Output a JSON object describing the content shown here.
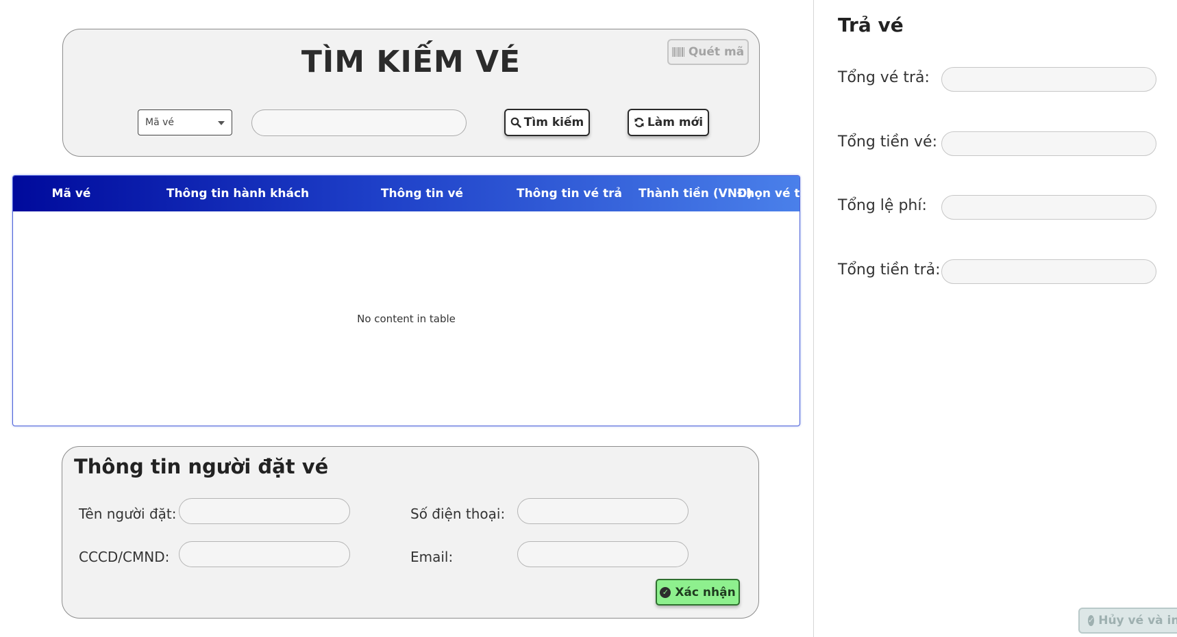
{
  "search": {
    "title": "TÌM KIẾM VÉ",
    "scan_label": "Quét mã",
    "select_value": "Mã vé",
    "input_value": "",
    "search_label": "Tìm kiếm",
    "refresh_label": "Làm mới"
  },
  "table": {
    "columns": [
      "Mã vé",
      "Thông tin hành khách",
      "Thông tin vé",
      "Thông tin vé trả",
      "Thành tiền (VNĐ)",
      "Chọn vé trả"
    ],
    "empty_message": "No content in table",
    "header_colors": [
      "#000a9c",
      "#1d3ec7",
      "#4a80ea"
    ]
  },
  "booker": {
    "title": "Thông tin người đặt vé",
    "name_label": "Tên người đặt:",
    "phone_label": "Số điện thoại:",
    "id_label": "CCCD/CMND:",
    "email_label": "Email:",
    "confirm_label": "Xác nhận"
  },
  "refund": {
    "title": "Trả vé",
    "total_tickets_label": "Tổng vé trả:",
    "total_ticket_price_label": "Tổng tiền vé:",
    "total_fee_label": "Tổng lệ phí:",
    "total_refund_label": "Tổng tiền trả:",
    "cancel_print_label": "Hủy vé và in phiếu"
  },
  "colors": {
    "confirm": "#8ef08e",
    "card_bg": "#f2f2f2"
  }
}
